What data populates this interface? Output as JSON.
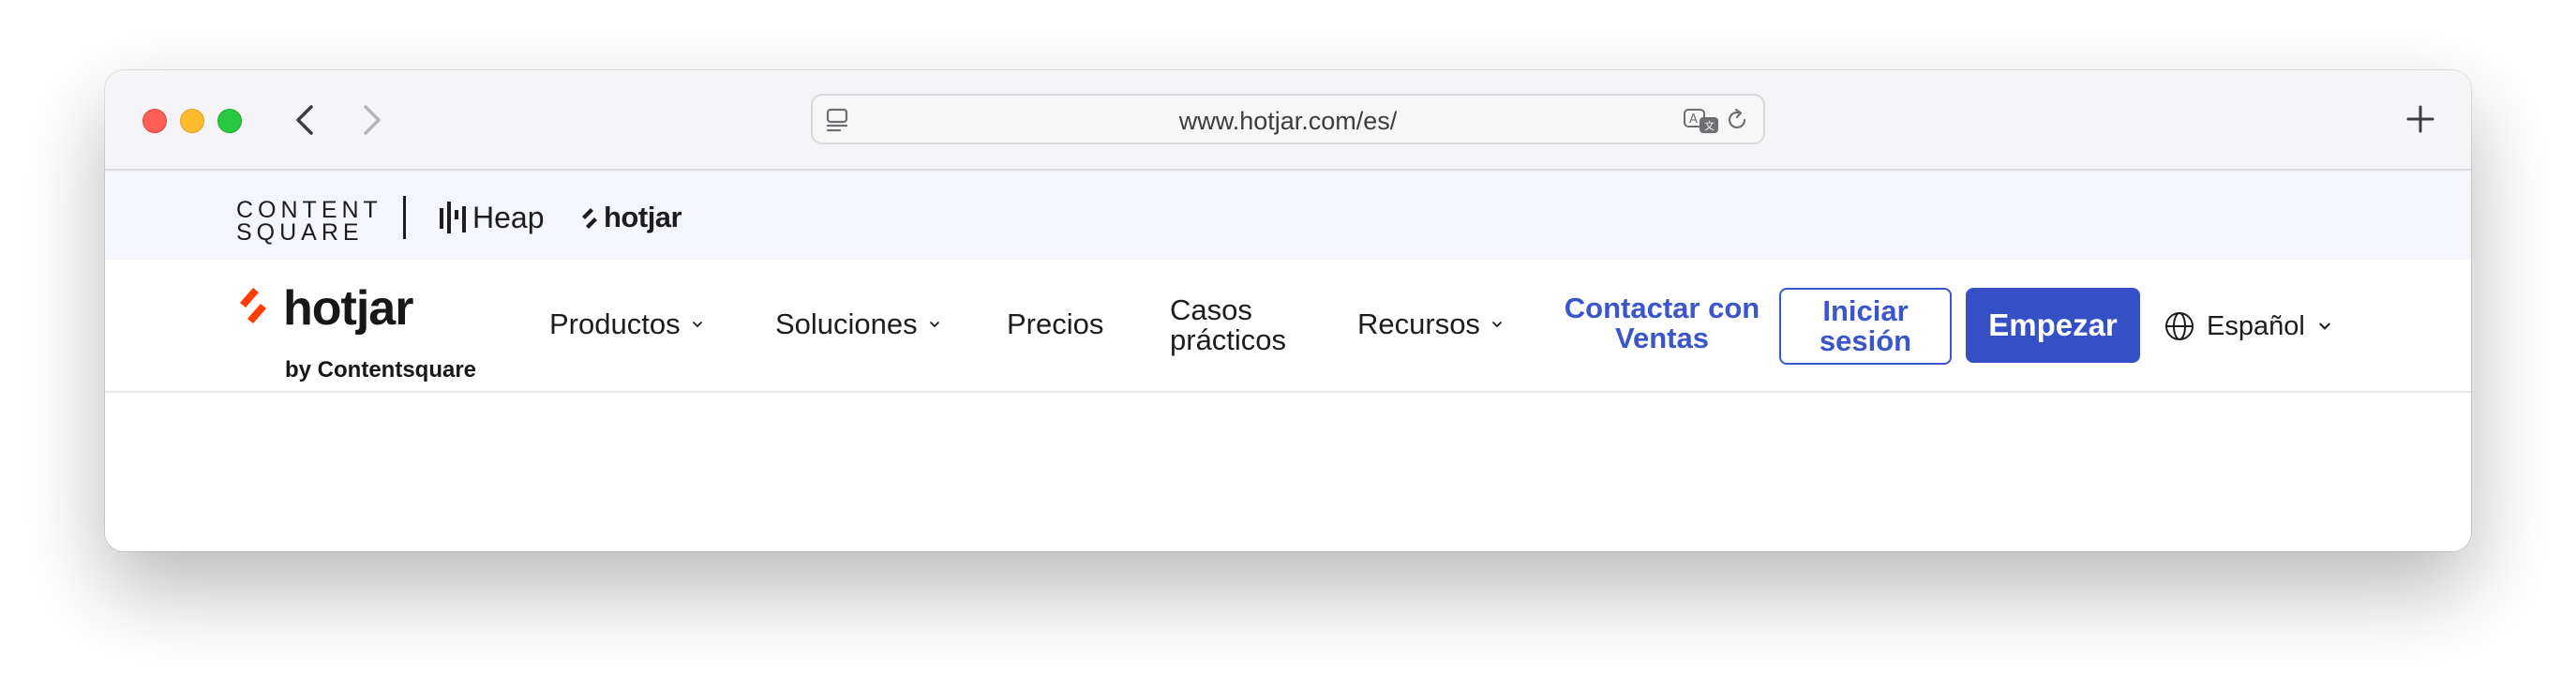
{
  "browser": {
    "url": "www.hotjar.com/es/",
    "traffic_lights": {
      "red": "#fe5f57",
      "yellow": "#febc2e",
      "green": "#28c840"
    },
    "icons": [
      "chevron-left-icon",
      "chevron-right-icon",
      "tabs-icon",
      "translate-icon",
      "reload-icon",
      "plus-icon"
    ]
  },
  "brand_bar": {
    "contentsquare_line1": "CONTENT",
    "contentsquare_line2": "SQUARE",
    "heap": "Heap",
    "hotjar": "hotjar"
  },
  "nav": {
    "logo_word": "hotjar",
    "logo_byline": "by Contentsquare",
    "items": [
      {
        "label": "Productos",
        "dropdown": true
      },
      {
        "label": "Soluciones",
        "dropdown": true
      },
      {
        "label": "Precios",
        "dropdown": false
      },
      {
        "label_line1": "Casos",
        "label_line2": "prácticos",
        "dropdown": false
      },
      {
        "label": "Recursos",
        "dropdown": true
      }
    ],
    "contact_line1": "Contactar con",
    "contact_line2": "Ventas",
    "login_line1": "Iniciar",
    "login_line2": "sesión",
    "signup": "Empezar",
    "language": "Español"
  },
  "colors": {
    "brand_blue": "#3450c4",
    "link_blue": "#3a56c9",
    "hotjar_red": "#ff3c00",
    "brand_bar_bg": "#f4f6fb"
  }
}
